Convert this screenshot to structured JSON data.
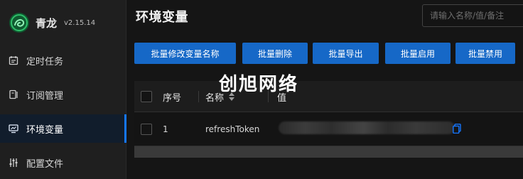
{
  "app": {
    "name": "青龙",
    "version": "v2.15.14",
    "brand_color": "#1a8a4a"
  },
  "sidebar": {
    "items": [
      {
        "label": "定时任务",
        "icon": "calendar-icon"
      },
      {
        "label": "订阅管理",
        "icon": "subscribe-icon"
      },
      {
        "label": "环境变量",
        "icon": "monitor-icon",
        "active": true
      },
      {
        "label": "配置文件",
        "icon": "settings-sliders-icon"
      }
    ]
  },
  "header": {
    "title": "环境变量",
    "search_placeholder": "请输入名称/值/备注"
  },
  "toolbar": {
    "buttons": [
      "批量修改变量名称",
      "批量删除",
      "批量导出",
      "批量启用",
      "批量禁用"
    ],
    "accent": "#1668c7"
  },
  "table": {
    "columns": [
      "序号",
      "名称",
      "值"
    ],
    "rows": [
      {
        "index": "1",
        "name": "refreshToken"
      }
    ]
  },
  "watermark": "创旭网络"
}
